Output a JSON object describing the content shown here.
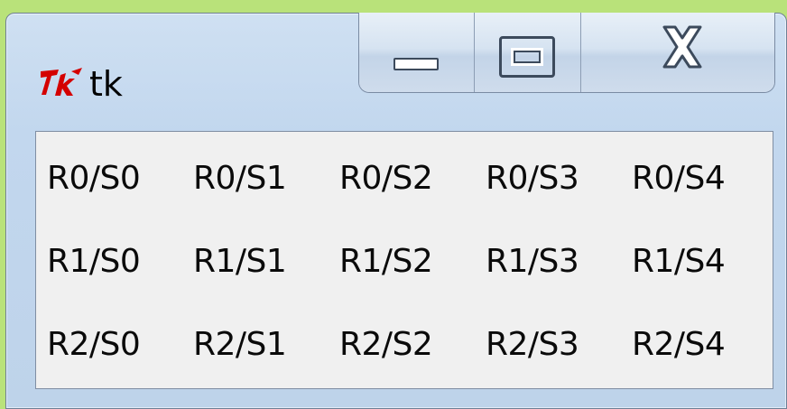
{
  "window": {
    "title": "tk",
    "app_icon": "tk-feather-icon",
    "controls": {
      "minimize": "minimize-icon",
      "maximize": "maximize-icon",
      "close": "close-icon"
    }
  },
  "grid": {
    "rows": [
      [
        "R0/S0",
        "R0/S1",
        "R0/S2",
        "R0/S3",
        "R0/S4"
      ],
      [
        "R1/S0",
        "R1/S1",
        "R1/S2",
        "R1/S3",
        "R1/S4"
      ],
      [
        "R2/S0",
        "R2/S1",
        "R2/S2",
        "R2/S3",
        "R2/S4"
      ]
    ]
  },
  "colors": {
    "desktop": "#b9e27a",
    "frame": "#c2d7ee",
    "client": "#f0f0f0",
    "icon_red": "#d40000"
  }
}
